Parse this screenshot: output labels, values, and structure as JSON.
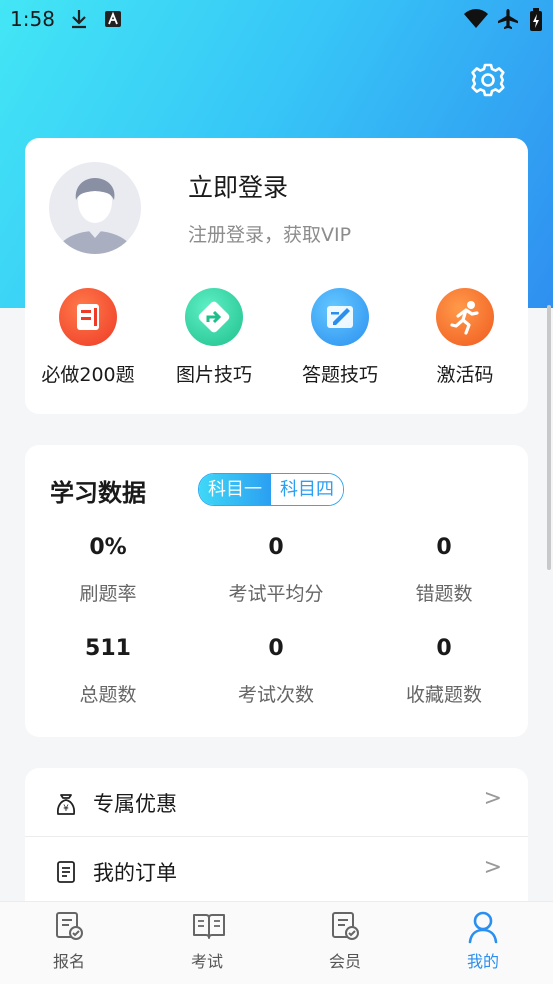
{
  "status_bar": {
    "time": "1:58"
  },
  "profile": {
    "login_title": "立即登录",
    "login_subtitle": "注册登录，获取VIP"
  },
  "quick_actions": [
    {
      "label": "必做200题",
      "icon": "document-icon",
      "color": "#f0522f"
    },
    {
      "label": "图片技巧",
      "icon": "direction-sign-icon",
      "color": "#2fcfa0"
    },
    {
      "label": "答题技巧",
      "icon": "edit-note-icon",
      "color": "#2f9df0"
    },
    {
      "label": "激活码",
      "icon": "running-man-icon",
      "color": "#f56a25"
    }
  ],
  "study_data": {
    "title": "学习数据",
    "subjects": [
      "科目一",
      "科目四"
    ],
    "selected_subject": "科目一",
    "stats": [
      {
        "value": "0%",
        "label": "刷题率"
      },
      {
        "value": "0",
        "label": "考试平均分"
      },
      {
        "value": "0",
        "label": "错题数"
      },
      {
        "value": "511",
        "label": "总题数"
      },
      {
        "value": "0",
        "label": "考试次数"
      },
      {
        "value": "0",
        "label": "收藏题数"
      }
    ]
  },
  "menu": [
    {
      "label": "专属优惠",
      "icon": "money-bag-icon",
      "chevron": ">"
    },
    {
      "label": "我的订单",
      "icon": "order-list-icon",
      "chevron": ">"
    }
  ],
  "tabs": [
    {
      "label": "报名",
      "icon": "signup-doc-icon"
    },
    {
      "label": "考试",
      "icon": "book-icon"
    },
    {
      "label": "会员",
      "icon": "member-doc-icon"
    },
    {
      "label": "我的",
      "icon": "person-icon",
      "active": true
    }
  ],
  "colors": {
    "accent": "#2a8ff0",
    "hero_start": "#43e6f5",
    "hero_end": "#2f8ff0"
  }
}
